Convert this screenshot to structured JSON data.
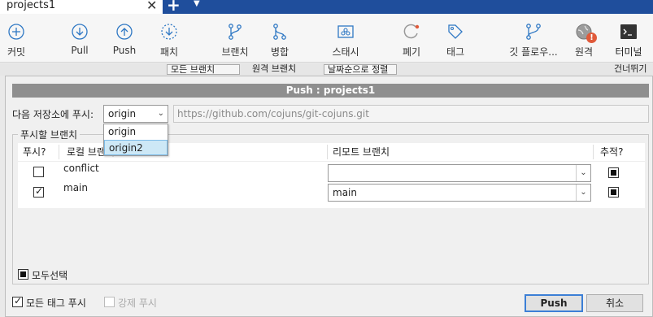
{
  "tab": {
    "title": "projects1",
    "close": "✕",
    "add": "+",
    "menu": "▼"
  },
  "toolbar": {
    "items": [
      {
        "label": "커밋"
      },
      {
        "label": "Pull"
      },
      {
        "label": "Push"
      },
      {
        "label": "패치"
      },
      {
        "label": "브랜치"
      },
      {
        "label": "병합"
      },
      {
        "label": "스태시"
      },
      {
        "label": "폐기"
      },
      {
        "label": "태그"
      },
      {
        "label": "깃 플로우..."
      },
      {
        "label": "원격"
      },
      {
        "label": "터미널"
      }
    ],
    "badge": "!"
  },
  "background": {
    "branch_filter": "모든 브랜치",
    "remote_branch": "원격 브랜치",
    "sort": "날짜순으로 정렬",
    "skip": "건너뛰기"
  },
  "dialog": {
    "title": "Push :  projects1",
    "push_to_label": "다음 저장소에 푸시:",
    "remote_value": "origin",
    "remote_url": "https://github.com/cojuns/git-cojuns.git",
    "dropdown_options": [
      "origin",
      "origin2"
    ],
    "dropdown_selected": "origin2",
    "branches_group_label": "푸시할 브랜치",
    "columns": {
      "push": "푸시?",
      "local": "로컬 브랜치",
      "remote": "리모트 브랜치",
      "track": "추적?"
    },
    "rows": [
      {
        "push": false,
        "local": "conflict",
        "remote": "",
        "track": true
      },
      {
        "push": true,
        "local": "main",
        "remote": "main",
        "track": true
      }
    ],
    "select_all": "모두선택",
    "push_all_tags": "모든 태그 푸시",
    "force_push": "강제 푸시",
    "push_button": "Push",
    "cancel_button": "취소"
  },
  "colors": {
    "accent": "#1f4e9c",
    "title_bar": "#8f8f8f",
    "selection": "#cde8f6",
    "badge": "#e05a3a"
  }
}
